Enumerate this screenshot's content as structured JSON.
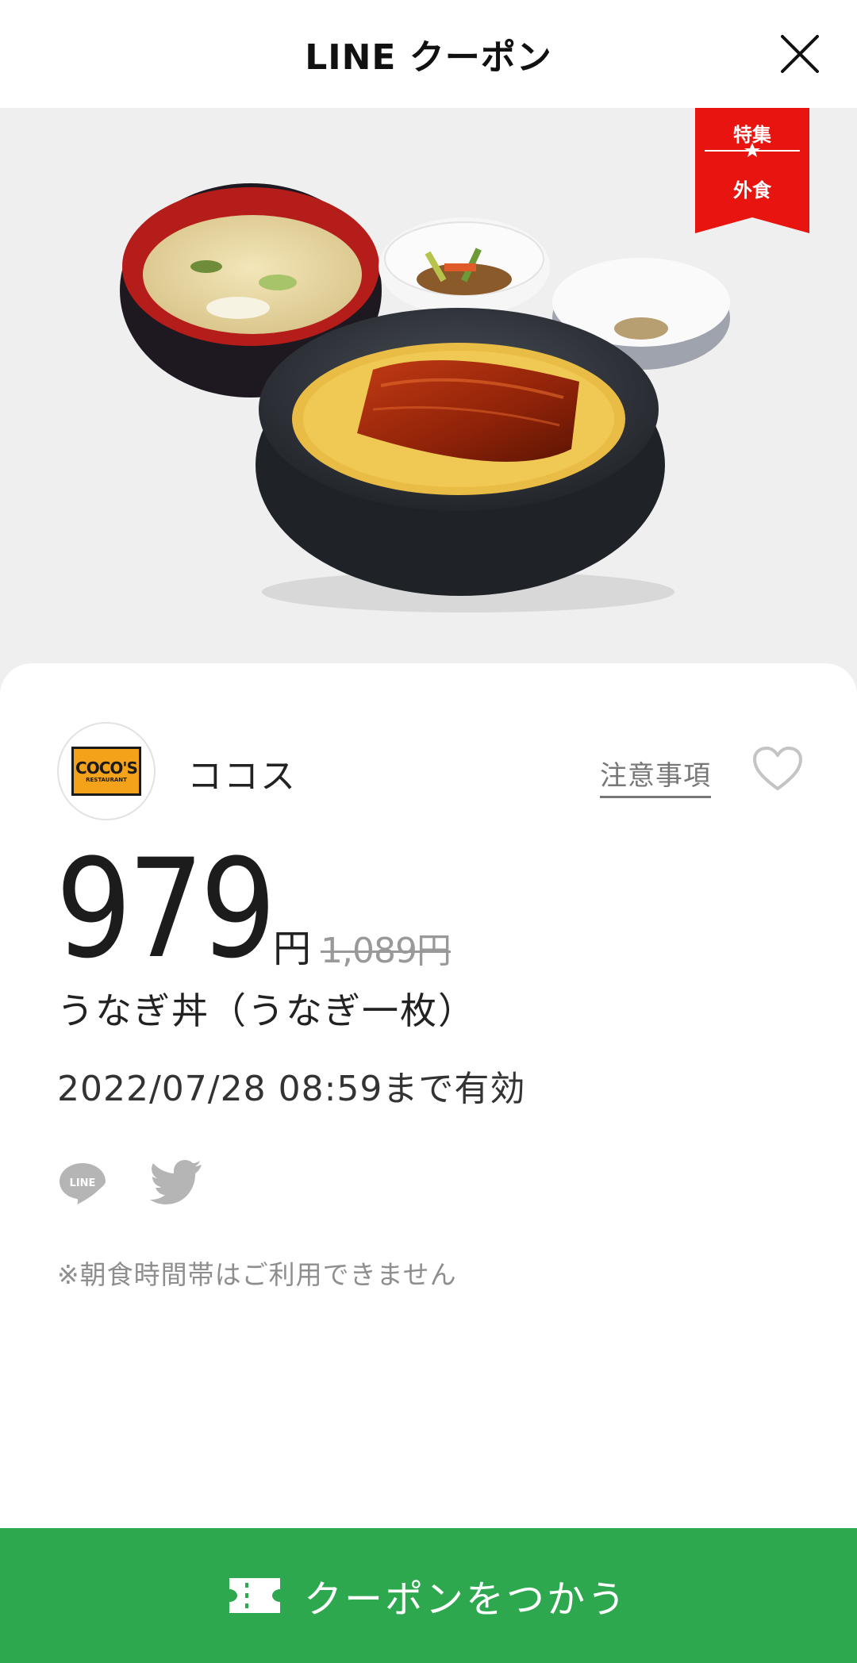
{
  "header": {
    "title": "LINE クーポン"
  },
  "hero": {
    "badge": {
      "top": "特集",
      "bottom": "外食"
    }
  },
  "store": {
    "name": "ココス",
    "logo_text": "COCO'S",
    "logo_subtext": "RESTAURANT",
    "notice_label": "注意事項"
  },
  "price": {
    "value": "979",
    "unit": "円",
    "original": "1,089円"
  },
  "item": {
    "title": "うなぎ丼（うなぎ一枚）"
  },
  "expiry": {
    "text": "2022/07/28  08:59まで有効"
  },
  "share": {
    "line_label": "LINE"
  },
  "note": {
    "text": "※朝食時間帯はご利用できません"
  },
  "cta": {
    "label": "クーポンをつかう"
  },
  "colors": {
    "accent_green": "#2ea84f",
    "badge_red": "#e8140f",
    "logo_orange": "#f4a21a"
  }
}
